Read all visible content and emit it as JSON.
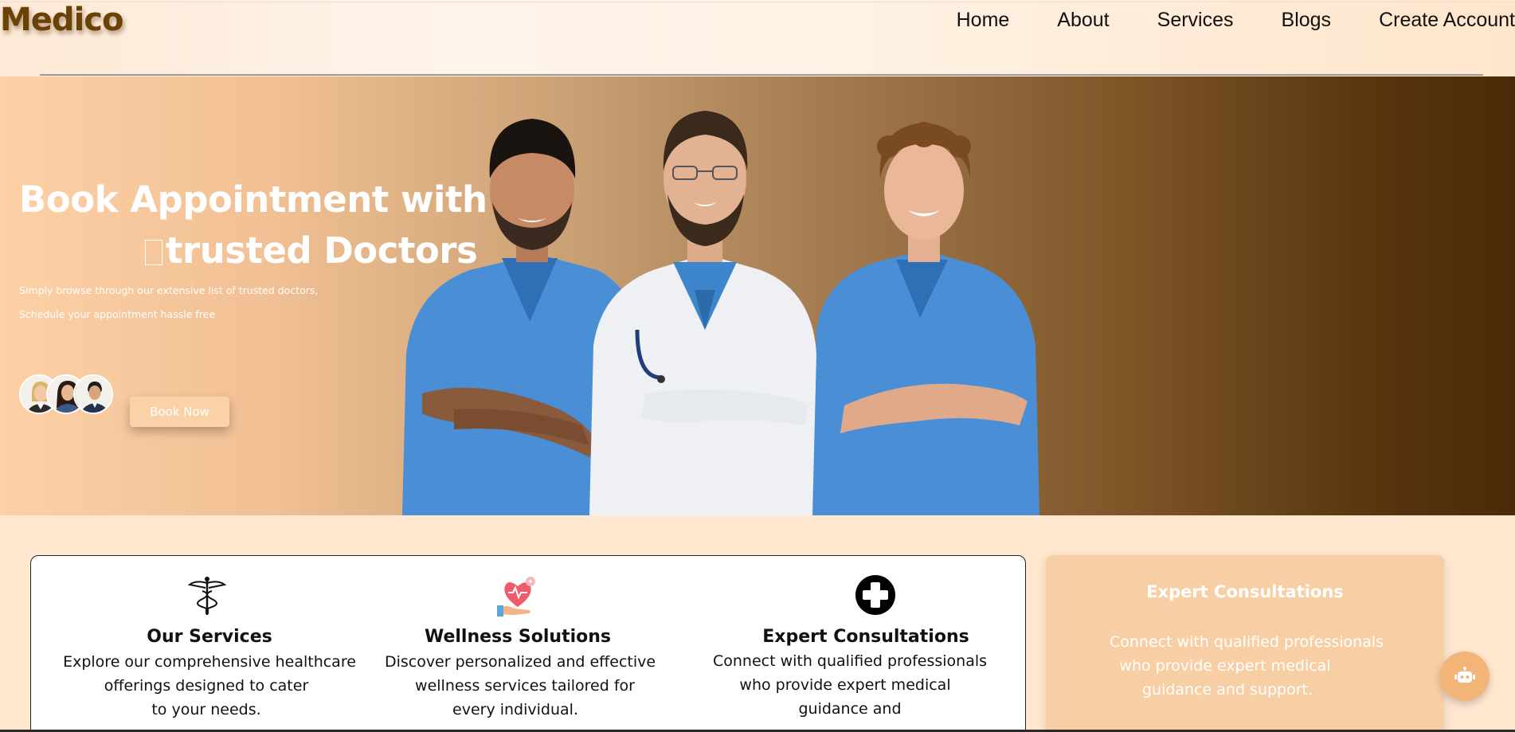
{
  "header": {
    "logo": "Medico",
    "nav": [
      "Home",
      "About",
      "Services",
      "Blogs",
      "Create Account"
    ]
  },
  "hero": {
    "title_line1": "Book Appointment with",
    "title_line2": "trusted Doctors",
    "subtitle_line1": "Simply browse through our extensive list of trusted doctors,",
    "subtitle_line2": "Schedule your appointment hassle free",
    "cta_label": "Book Now"
  },
  "services": [
    {
      "icon": "caduceus-icon",
      "title": "Our Services",
      "lines": [
        "Explore our comprehensive healthcare",
        "offerings designed to cater",
        "to your needs."
      ]
    },
    {
      "icon": "heart-hand-icon",
      "title": "Wellness Solutions",
      "lines": [
        "Discover personalized and effective",
        "wellness services tailored for",
        "every individual."
      ]
    },
    {
      "icon": "medical-cross-icon",
      "title": "Expert Consultations",
      "lines": [
        "Connect with qualified professionals",
        "who provide expert medical",
        "guidance and"
      ]
    }
  ],
  "consult_card": {
    "title": "Expert Consultations",
    "lines": [
      "Connect with qualified professionals",
      "who provide expert medical",
      "guidance and support."
    ]
  },
  "colors": {
    "brand": "#6a4205",
    "hero_start": "#fdd0a6",
    "hero_end": "#4a2a08",
    "accent_card": "#f8cfa4",
    "scrub_blue": "#4a8fd6"
  },
  "chat_button_icon": "robot-icon"
}
